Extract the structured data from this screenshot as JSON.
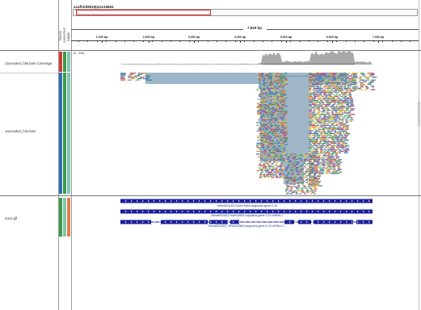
{
  "locus": {
    "name": "scaffold8519|size19664"
  },
  "ruler": {
    "span_label": "7,829 bp",
    "ticks": [
      "1,000 bp",
      "2,000 bp",
      "3,000 bp",
      "4,000 bp",
      "5,000 bp",
      "6,000 bp",
      "7,000 bp"
    ]
  },
  "attribute_headers": [
    "TRACK",
    "DATA FILE",
    "NAME"
  ],
  "coverage": {
    "range_label": "[0 - 950]"
  },
  "tracks": [
    {
      "label": "1accepted_hits.bam Coverage"
    },
    {
      "label": "1accepted_hits.bam"
    },
    {
      "label": "mecr.gff"
    }
  ],
  "features": [
    {
      "label": "Mecal0010617/size19664-augustus-gene-0.10"
    },
    {
      "label": "Mecal0010617/size19664-augustus-gene-0.10-mRNA-1"
    },
    {
      "label": "Mecal0010617-R/size19664-augustus-gene-0.10-mRNA-1..."
    }
  ],
  "colors": {
    "attr_red": "#d23a33",
    "attr_green": "#3e9a4a",
    "attr_teal": "#7cc6b0",
    "attr_blue": "#2d6fb8",
    "attr_orange": "#e37e4a",
    "gene_blue": "#1a1f9a",
    "read_steel": "#9fb6c9",
    "coverage_gray": "#a9a9a9"
  }
}
